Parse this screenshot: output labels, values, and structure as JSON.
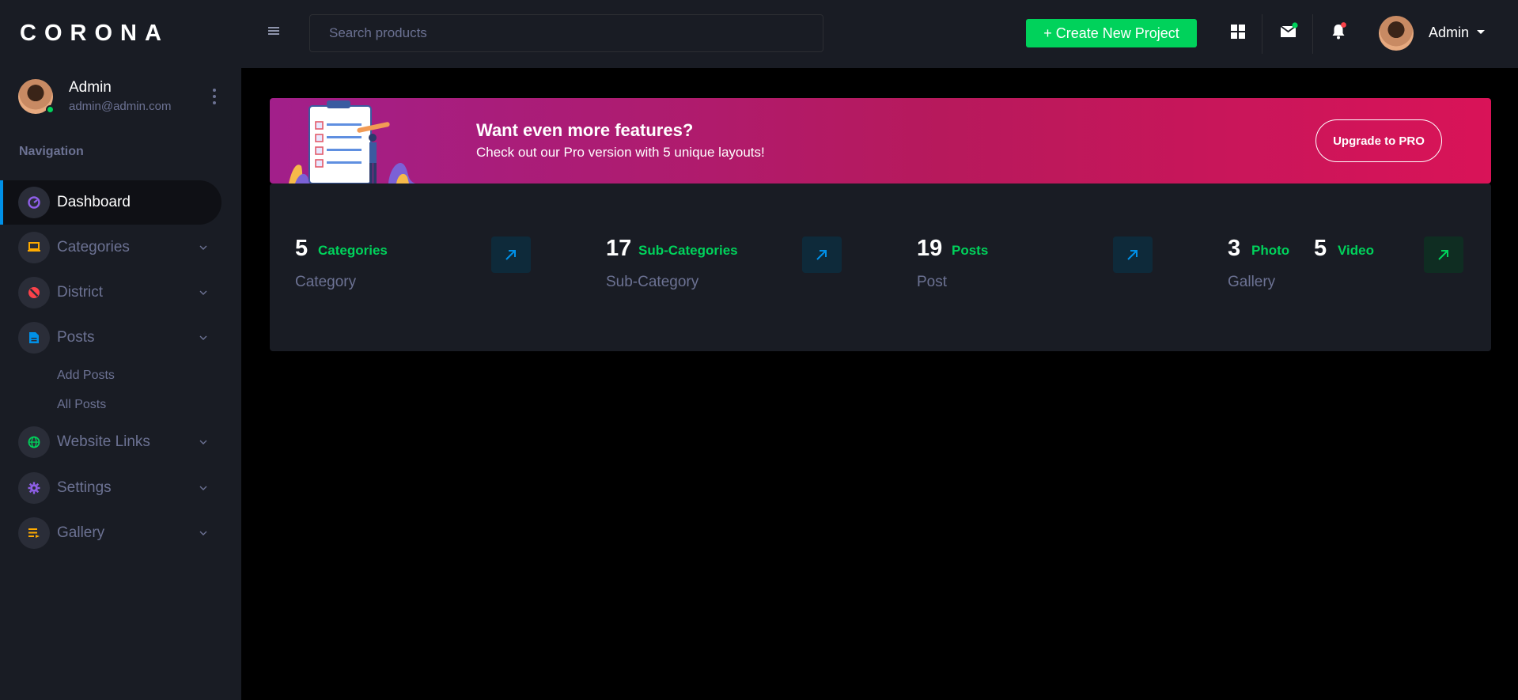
{
  "sidebar": {
    "brand": "CORONA",
    "profile": {
      "name": "Admin",
      "email": "admin@admin.com"
    },
    "nav_heading": "Navigation",
    "items": [
      {
        "label": "Dashboard",
        "icon": "speedometer-icon",
        "color": "#8f5fe8",
        "active": true
      },
      {
        "label": "Categories",
        "icon": "laptop-icon",
        "color": "#ffab00"
      },
      {
        "label": "District",
        "icon": "block-icon",
        "color": "#fc424a"
      },
      {
        "label": "Posts",
        "icon": "file-icon",
        "color": "#0090e7"
      },
      {
        "label": "Website Links",
        "icon": "globe-icon",
        "color": "#00d25b"
      },
      {
        "label": "Settings",
        "icon": "gear-icon",
        "color": "#8f5fe8"
      },
      {
        "label": "Gallery",
        "icon": "playlist-icon",
        "color": "#ffab00"
      }
    ],
    "posts_sub": [
      "Add Posts",
      "All Posts"
    ]
  },
  "topbar": {
    "search_placeholder": "Search products",
    "create_label": "+ Create New Project",
    "user_name": "Admin"
  },
  "banner": {
    "title": "Want even more features?",
    "subtitle": "Check out our Pro version with 5 unique layouts!",
    "button": "Upgrade to PRO"
  },
  "stats": [
    {
      "num": "5",
      "label": "Categories",
      "sub": "Category",
      "arrow_color": "#0090e7"
    },
    {
      "num": "17",
      "label": "Sub-Categories",
      "sub": "Sub-Category",
      "arrow_color": "#0090e7"
    },
    {
      "num": "19",
      "label": "Posts",
      "sub": "Post",
      "arrow_color": "#0090e7"
    },
    {
      "num": "3",
      "label": "Photo",
      "num2": "5",
      "label2": "Video",
      "sub": "Gallery",
      "arrow_color": "#00d25b"
    }
  ],
  "colors": {
    "accent_green": "#00d25b",
    "accent_blue": "#0090e7",
    "sidebar_bg": "#191c24",
    "muted_text": "#6c7293"
  }
}
